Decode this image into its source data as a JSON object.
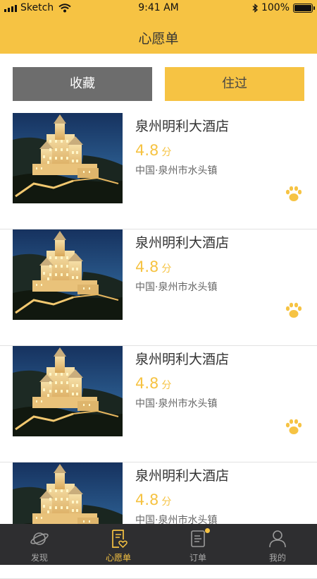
{
  "status_bar": {
    "carrier": "Sketch",
    "time": "9:41 AM",
    "battery": "100%"
  },
  "header": {
    "title": "心愿单"
  },
  "tabs": [
    {
      "label": "收藏",
      "active": true
    },
    {
      "label": "住过",
      "active": false
    }
  ],
  "hotels": [
    {
      "name": "泉州明利大酒店",
      "rating": "4.8",
      "rating_unit": "分",
      "location": "中国·泉州市水头镇"
    },
    {
      "name": "泉州明利大酒店",
      "rating": "4.8",
      "rating_unit": "分",
      "location": "中国·泉州市水头镇"
    },
    {
      "name": "泉州明利大酒店",
      "rating": "4.8",
      "rating_unit": "分",
      "location": "中国·泉州市水头镇"
    },
    {
      "name": "泉州明利大酒店",
      "rating": "4.8",
      "rating_unit": "分",
      "location": "中国·泉州市水头镇"
    }
  ],
  "tab_bar": [
    {
      "label": "发现",
      "icon": "planet-icon",
      "active": false
    },
    {
      "label": "心愿单",
      "icon": "wishlist-icon",
      "active": true
    },
    {
      "label": "订单",
      "icon": "order-icon",
      "active": false,
      "badge": true
    },
    {
      "label": "我的",
      "icon": "person-icon",
      "active": false
    }
  ],
  "colors": {
    "accent": "#f6c343",
    "dark_tab": "#6d6d6d",
    "tab_bar_bg": "#2e2e30"
  }
}
